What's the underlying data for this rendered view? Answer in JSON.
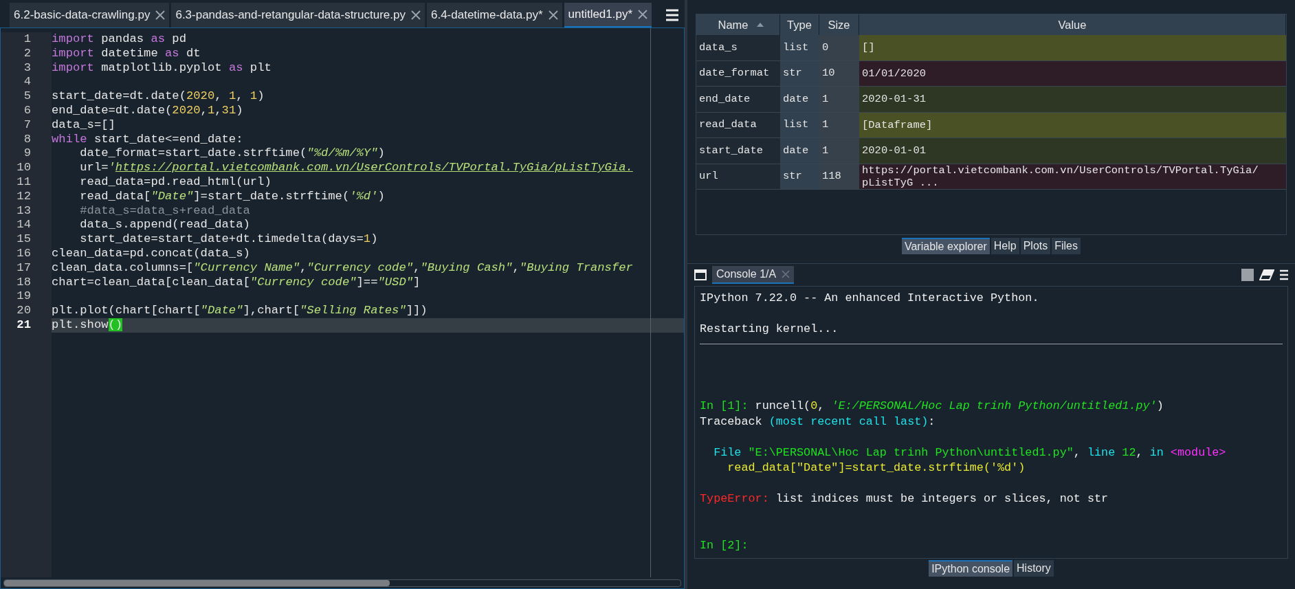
{
  "editor": {
    "tabs": [
      {
        "label": "6.2-basic-data-crawling.py",
        "selected": false
      },
      {
        "label": "6.3-pandas-and-retangular-data-structure.py",
        "selected": false
      },
      {
        "label": "6.4-datetime-data.py*",
        "selected": false
      },
      {
        "label": "untitled1.py*",
        "selected": true
      }
    ],
    "lines": [
      {
        "number": "1",
        "current": false,
        "tokens": [
          {
            "t": "import",
            "kind": "keyword"
          },
          {
            "t": " pandas ",
            "kind": "plain"
          },
          {
            "t": "as",
            "kind": "keyword"
          },
          {
            "t": " pd",
            "kind": "plain"
          }
        ]
      },
      {
        "number": "2",
        "current": false,
        "tokens": [
          {
            "t": "import",
            "kind": "keyword"
          },
          {
            "t": " datetime ",
            "kind": "plain"
          },
          {
            "t": "as",
            "kind": "keyword"
          },
          {
            "t": " dt",
            "kind": "plain"
          }
        ]
      },
      {
        "number": "3",
        "current": false,
        "tokens": [
          {
            "t": "import",
            "kind": "keyword"
          },
          {
            "t": " matplotlib.pyplot ",
            "kind": "plain"
          },
          {
            "t": "as",
            "kind": "keyword"
          },
          {
            "t": " plt",
            "kind": "plain"
          }
        ]
      },
      {
        "number": "4",
        "current": false
      },
      {
        "number": "5",
        "current": false,
        "tokens": [
          {
            "t": "start_date=dt.date(",
            "kind": "plain"
          },
          {
            "t": "2020",
            "kind": "number"
          },
          {
            "t": ", ",
            "kind": "plain"
          },
          {
            "t": "1",
            "kind": "number"
          },
          {
            "t": ", ",
            "kind": "plain"
          },
          {
            "t": "1",
            "kind": "number"
          },
          {
            "t": ")",
            "kind": "plain"
          }
        ]
      },
      {
        "number": "6",
        "current": false,
        "tokens": [
          {
            "t": "end_date=dt.date(",
            "kind": "plain"
          },
          {
            "t": "2020",
            "kind": "number"
          },
          {
            "t": ",",
            "kind": "plain"
          },
          {
            "t": "1",
            "kind": "number"
          },
          {
            "t": ",",
            "kind": "plain"
          },
          {
            "t": "31",
            "kind": "number"
          },
          {
            "t": ")",
            "kind": "plain"
          }
        ]
      },
      {
        "number": "7",
        "current": false,
        "tokens": [
          {
            "t": "data_s=[]",
            "kind": "plain"
          }
        ]
      },
      {
        "number": "8",
        "current": false,
        "tokens": [
          {
            "t": "while",
            "kind": "keyword"
          },
          {
            "t": " start_date<=end_date:",
            "kind": "plain"
          }
        ]
      },
      {
        "number": "9",
        "current": false,
        "tokens": [
          {
            "t": "    date_format=start_date.strftime(",
            "kind": "plain"
          },
          {
            "t": "\"%d/%m/%Y\"",
            "kind": "string"
          },
          {
            "t": ")",
            "kind": "plain"
          }
        ]
      },
      {
        "number": "10",
        "current": false,
        "tokens": [
          {
            "t": "    url=",
            "kind": "plain"
          },
          {
            "t": "'",
            "kind": "string"
          },
          {
            "t": "https://portal.vietcombank.com.vn/UserControls/TVPortal.TyGia/pListTyGia.",
            "kind": "link"
          }
        ]
      },
      {
        "number": "11",
        "current": false,
        "tokens": [
          {
            "t": "    read_data=pd.read_html(url)",
            "kind": "plain"
          }
        ]
      },
      {
        "number": "12",
        "current": false,
        "tokens": [
          {
            "t": "    read_data[",
            "kind": "plain"
          },
          {
            "t": "\"Date\"",
            "kind": "string"
          },
          {
            "t": "]=start_date.strftime(",
            "kind": "plain"
          },
          {
            "t": "'%d'",
            "kind": "string"
          },
          {
            "t": ")",
            "kind": "plain"
          }
        ]
      },
      {
        "number": "13",
        "current": false,
        "tokens": [
          {
            "t": "    #data_s=data_s+read_data",
            "kind": "comment"
          }
        ]
      },
      {
        "number": "14",
        "current": false,
        "tokens": [
          {
            "t": "    data_s.append(read_data)",
            "kind": "plain"
          }
        ]
      },
      {
        "number": "15",
        "current": false,
        "tokens": [
          {
            "t": "    start_date=start_date+dt.timedelta(days=",
            "kind": "plain"
          },
          {
            "t": "1",
            "kind": "number"
          },
          {
            "t": ")",
            "kind": "plain"
          }
        ]
      },
      {
        "number": "16",
        "current": false,
        "tokens": [
          {
            "t": "clean_data=pd.concat(data_s)",
            "kind": "plain"
          }
        ]
      },
      {
        "number": "17",
        "current": false,
        "tokens": [
          {
            "t": "clean_data.columns=[",
            "kind": "plain"
          },
          {
            "t": "\"Currency Name\"",
            "kind": "string"
          },
          {
            "t": ",",
            "kind": "plain"
          },
          {
            "t": "\"Currency code\"",
            "kind": "string"
          },
          {
            "t": ",",
            "kind": "plain"
          },
          {
            "t": "\"Buying Cash\"",
            "kind": "string"
          },
          {
            "t": ",",
            "kind": "plain"
          },
          {
            "t": "\"Buying Transfer",
            "kind": "string"
          }
        ]
      },
      {
        "number": "18",
        "current": false,
        "tokens": [
          {
            "t": "chart=clean_data[clean_data[",
            "kind": "plain"
          },
          {
            "t": "\"Currency code\"",
            "kind": "string"
          },
          {
            "t": "]==",
            "kind": "plain"
          },
          {
            "t": "\"USD\"",
            "kind": "string"
          },
          {
            "t": "]",
            "kind": "plain"
          }
        ]
      },
      {
        "number": "19",
        "current": false
      },
      {
        "number": "20",
        "current": false,
        "tokens": [
          {
            "t": "plt.plot(chart[chart[",
            "kind": "plain"
          },
          {
            "t": "\"Date\"",
            "kind": "string"
          },
          {
            "t": "],chart[",
            "kind": "plain"
          },
          {
            "t": "\"Selling Rates\"",
            "kind": "string"
          },
          {
            "t": "]])",
            "kind": "plain"
          }
        ]
      },
      {
        "number": "21",
        "current": true,
        "tokens": [
          {
            "t": "plt.show",
            "kind": "plain"
          },
          {
            "t": "()",
            "kind": "match"
          }
        ]
      }
    ]
  },
  "variable_explorer": {
    "columns": [
      "Name",
      "Type",
      "Size",
      "Value"
    ],
    "rows": [
      {
        "name": "data_s",
        "type": "list",
        "size": "0",
        "value": "[]"
      },
      {
        "name": "date_format",
        "type": "str",
        "size": "10",
        "value": "01/01/2020"
      },
      {
        "name": "end_date",
        "type": "date",
        "size": "1",
        "value": "2020-01-31"
      },
      {
        "name": "read_data",
        "type": "list",
        "size": "1",
        "value": "[Dataframe]"
      },
      {
        "name": "start_date",
        "type": "date",
        "size": "1",
        "value": "2020-01-01"
      },
      {
        "name": "url",
        "type": "str",
        "size": "118",
        "value": "https://portal.vietcombank.com.vn/UserControls/TVPortal.TyGia/\npListTyG ..."
      }
    ],
    "pane_tabs": [
      {
        "label": "Variable explorer",
        "selected": true
      },
      {
        "label": "Help",
        "selected": false
      },
      {
        "label": "Plots",
        "selected": false
      },
      {
        "label": "Files",
        "selected": false
      }
    ]
  },
  "console": {
    "tab": "Console 1/A",
    "lines": [
      {
        "kind": "text",
        "segments": [
          {
            "t": "IPython 7.22.0 -- An enhanced Interactive Python.",
            "kind": "plain"
          }
        ]
      },
      {
        "kind": "blank"
      },
      {
        "kind": "text",
        "segments": [
          {
            "t": "Restarting kernel...",
            "kind": "plain"
          }
        ]
      },
      {
        "kind": "rule"
      },
      {
        "kind": "blank"
      },
      {
        "kind": "blank"
      },
      {
        "kind": "blank"
      },
      {
        "kind": "text",
        "segments": [
          {
            "t": "In [1]:",
            "kind": "prompt"
          },
          {
            "t": " runcell(",
            "kind": "plain"
          },
          {
            "t": "0",
            "kind": "number"
          },
          {
            "t": ", ",
            "kind": "plain"
          },
          {
            "t": "'E:/PERSONAL/Hoc Lap trinh Python/untitled1.py'",
            "kind": "string"
          },
          {
            "t": ")",
            "kind": "plain"
          }
        ]
      },
      {
        "kind": "text",
        "segments": [
          {
            "t": "Traceback ",
            "kind": "plain"
          },
          {
            "t": "(most recent call last)",
            "kind": "cyan"
          },
          {
            "t": ":",
            "kind": "plain"
          }
        ]
      },
      {
        "kind": "blank"
      },
      {
        "kind": "text",
        "segments": [
          {
            "t": "  File ",
            "kind": "cyan"
          },
          {
            "t": "\"E:\\PERSONAL\\Hoc Lap trinh Python\\untitled1.py\"",
            "kind": "prompt"
          },
          {
            "t": ", ",
            "kind": "plain"
          },
          {
            "t": "line ",
            "kind": "cyan"
          },
          {
            "t": "12",
            "kind": "prompt"
          },
          {
            "t": ", ",
            "kind": "plain"
          },
          {
            "t": "in ",
            "kind": "cyan"
          },
          {
            "t": "<module>",
            "kind": "magenta"
          }
        ]
      },
      {
        "kind": "text",
        "segments": [
          {
            "t": "    read_data[\"Date\"]=start_date.strftime('%d')",
            "kind": "number"
          }
        ]
      },
      {
        "kind": "blank"
      },
      {
        "kind": "text",
        "segments": [
          {
            "t": "TypeError:",
            "kind": "error"
          },
          {
            "t": " list indices must be integers or slices, not str",
            "kind": "plain"
          }
        ]
      },
      {
        "kind": "blank"
      },
      {
        "kind": "blank"
      },
      {
        "kind": "text",
        "segments": [
          {
            "t": "In [2]:",
            "kind": "prompt"
          }
        ]
      }
    ],
    "pane_tabs": [
      {
        "label": "IPython console",
        "selected": true
      },
      {
        "label": "History",
        "selected": false
      }
    ]
  }
}
